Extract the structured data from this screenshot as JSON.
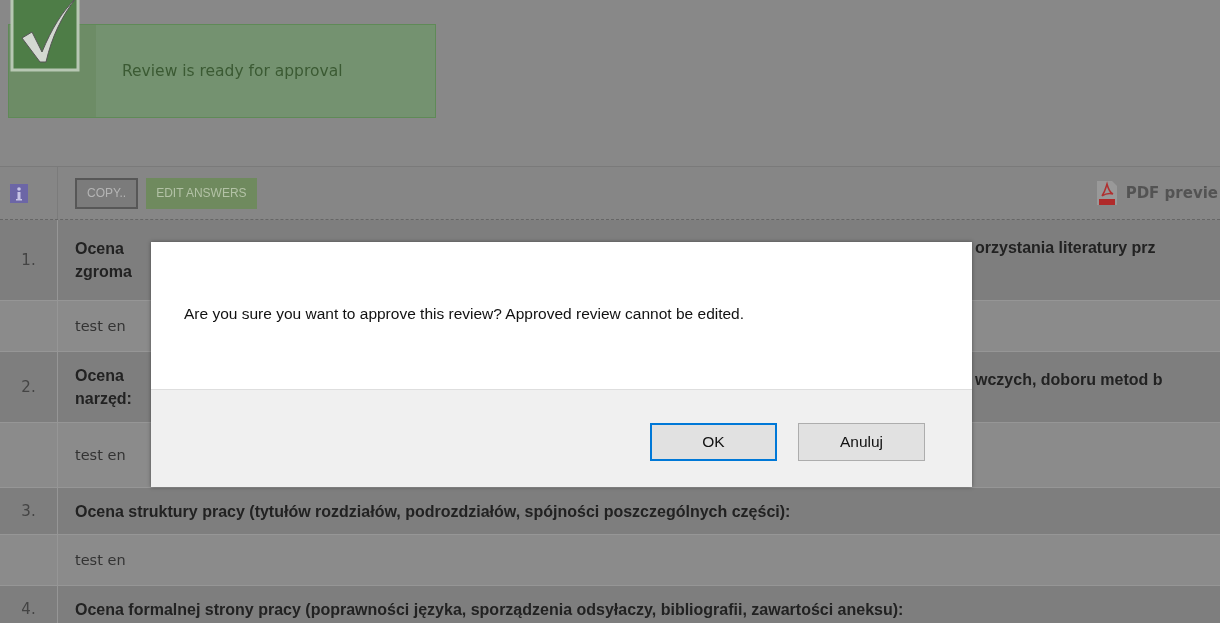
{
  "banner": {
    "message": "Review is ready for approval"
  },
  "toolbar": {
    "buttons": [
      {
        "label": "COPY..",
        "kind": "secondary"
      },
      {
        "label": "EDIT ANSWERS",
        "kind": "primary"
      }
    ],
    "pdf_link": "PDF previe"
  },
  "questions": [
    {
      "number": "1.",
      "kind": "covered",
      "text_left": [
        "Ocena",
        "zgroma"
      ],
      "text_right": "orzystania literatury prz",
      "answer": "test en"
    },
    {
      "number": "2.",
      "kind": "covered",
      "text_left": [
        "Ocena",
        "narzęd:"
      ],
      "text_right": "wczych, doboru metod b",
      "answer": "test en"
    },
    {
      "number": "3.",
      "kind": "full",
      "text": "Ocena struktury pracy (tytułów rozdziałów, podrozdziałów, spójności poszczególnych części):",
      "answer": "test en"
    },
    {
      "number": "4.",
      "kind": "full",
      "text": "Ocena formalnej strony pracy (poprawności języka, sporządzenia odsyłaczy, bibliografii, zawartości aneksu):"
    }
  ],
  "dialog": {
    "message": "Are you sure you want to approve this review? Approved review cannot be edited.",
    "buttons": [
      {
        "label": "OK",
        "selected": true
      },
      {
        "label": "Anuluj",
        "selected": false
      }
    ]
  }
}
